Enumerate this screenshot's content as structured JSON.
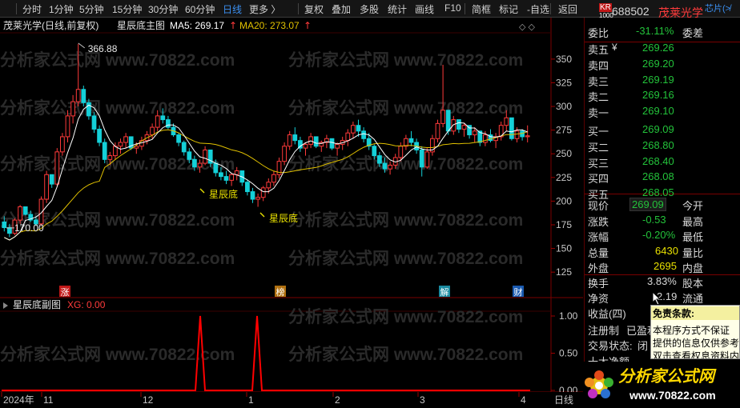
{
  "toolbar": {
    "items": [
      "分时",
      "1分钟",
      "5分钟",
      "15分钟",
      "30分钟",
      "60分钟",
      "日线",
      "更多 〉",
      "复权",
      "叠加",
      "多股",
      "统计",
      "画线",
      "F10",
      "简框",
      "标记",
      "-自选",
      "返回"
    ],
    "active": "日线"
  },
  "header": {
    "title": "茂莱光学(日线,前复权)",
    "indicator": "星辰底主图",
    "ma5_label": "MA5: 269.17",
    "ma20_label": "MA20: 273.07",
    "diamond_icons": "◇ ◇"
  },
  "sub_header": {
    "name": "星辰底副图",
    "xg_label": "XG: 0.00"
  },
  "chart_data": {
    "type": "candlestick",
    "y_ticks": [
      350.0,
      325.0,
      300.0,
      275.0,
      250.0,
      225.0,
      200.0,
      175.0,
      150.0,
      125.0
    ],
    "ylim": [
      115,
      382
    ],
    "high_label": "366.88",
    "low_label": "170.00",
    "x_labels": [
      "2024年",
      "11",
      "12",
      "1",
      "2",
      "3",
      "4"
    ],
    "x_axis_type": "日线",
    "sub_y_ticks": [
      "1.00",
      "0.50",
      "0.00"
    ],
    "annotations": [
      "星辰底",
      "星辰底"
    ],
    "event_markers": [
      "涨",
      "榜",
      "解",
      "财"
    ],
    "colors": {
      "up": "#ff3a3a",
      "down": "#14d0d8",
      "ma5": "#ffffff",
      "ma20": "#e0c000",
      "signal": "#ff0000"
    },
    "series": [
      {
        "name": "MA5"
      },
      {
        "name": "MA20"
      },
      {
        "name": "XG",
        "spikes_at": [
          "星辰底",
          "星辰底"
        ]
      }
    ],
    "candles": [
      [
        178,
        184,
        168,
        172
      ],
      [
        172,
        176,
        162,
        166
      ],
      [
        166,
        182,
        164,
        180
      ],
      [
        180,
        196,
        176,
        194
      ],
      [
        194,
        192,
        185,
        186
      ],
      [
        186,
        190,
        178,
        180
      ],
      [
        180,
        184,
        174,
        176
      ],
      [
        176,
        205,
        174,
        202
      ],
      [
        202,
        232,
        198,
        228
      ],
      [
        228,
        226,
        214,
        218
      ],
      [
        218,
        256,
        216,
        252
      ],
      [
        252,
        272,
        248,
        268
      ],
      [
        268,
        296,
        262,
        290
      ],
      [
        290,
        312,
        282,
        305
      ],
      [
        305,
        366,
        300,
        318
      ],
      [
        318,
        322,
        300,
        304
      ],
      [
        304,
        308,
        286,
        290
      ],
      [
        290,
        294,
        272,
        276
      ],
      [
        276,
        280,
        258,
        262
      ],
      [
        262,
        266,
        240,
        244
      ],
      [
        244,
        252,
        238,
        248
      ],
      [
        248,
        262,
        244,
        258
      ],
      [
        258,
        266,
        250,
        262
      ],
      [
        262,
        272,
        256,
        268
      ],
      [
        268,
        264,
        254,
        256
      ],
      [
        256,
        262,
        250,
        258
      ],
      [
        258,
        268,
        254,
        264
      ],
      [
        264,
        274,
        260,
        270
      ],
      [
        270,
        282,
        266,
        278
      ],
      [
        278,
        296,
        274,
        290
      ],
      [
        290,
        298,
        282,
        286
      ],
      [
        286,
        290,
        276,
        278
      ],
      [
        278,
        282,
        268,
        270
      ],
      [
        270,
        272,
        258,
        262
      ],
      [
        262,
        264,
        248,
        252
      ],
      [
        252,
        256,
        240,
        244
      ],
      [
        244,
        248,
        232,
        236
      ],
      [
        236,
        244,
        230,
        240
      ],
      [
        240,
        258,
        238,
        254
      ],
      [
        254,
        252,
        236,
        240
      ],
      [
        240,
        244,
        226,
        230
      ],
      [
        230,
        236,
        222,
        226
      ],
      [
        226,
        232,
        218,
        222
      ],
      [
        222,
        230,
        216,
        228
      ],
      [
        228,
        236,
        222,
        232
      ],
      [
        232,
        228,
        216,
        220
      ],
      [
        220,
        222,
        206,
        210
      ],
      [
        210,
        214,
        198,
        202
      ],
      [
        202,
        208,
        194,
        204
      ],
      [
        204,
        216,
        200,
        214
      ],
      [
        214,
        224,
        208,
        220
      ],
      [
        220,
        232,
        216,
        228
      ],
      [
        228,
        246,
        224,
        242
      ],
      [
        242,
        262,
        238,
        258
      ],
      [
        258,
        274,
        254,
        270
      ],
      [
        270,
        278,
        260,
        264
      ],
      [
        264,
        268,
        252,
        256
      ],
      [
        256,
        262,
        248,
        260
      ],
      [
        260,
        272,
        256,
        268
      ],
      [
        268,
        266,
        256,
        258
      ],
      [
        258,
        264,
        252,
        262
      ],
      [
        262,
        270,
        256,
        266
      ],
      [
        266,
        264,
        254,
        256
      ],
      [
        256,
        262,
        248,
        260
      ],
      [
        260,
        268,
        254,
        264
      ],
      [
        264,
        276,
        258,
        272
      ],
      [
        272,
        284,
        266,
        280
      ],
      [
        280,
        286,
        268,
        274
      ],
      [
        274,
        278,
        262,
        266
      ],
      [
        266,
        272,
        254,
        258
      ],
      [
        258,
        260,
        244,
        248
      ],
      [
        248,
        252,
        236,
        240
      ],
      [
        240,
        246,
        230,
        234
      ],
      [
        234,
        242,
        228,
        238
      ],
      [
        238,
        250,
        234,
        246
      ],
      [
        246,
        262,
        242,
        258
      ],
      [
        258,
        270,
        254,
        266
      ],
      [
        266,
        274,
        258,
        262
      ],
      [
        262,
        266,
        250,
        254
      ],
      [
        254,
        258,
        226,
        236
      ],
      [
        236,
        256,
        234,
        252
      ],
      [
        252,
        270,
        248,
        266
      ],
      [
        266,
        286,
        262,
        282
      ],
      [
        282,
        344,
        278,
        296
      ],
      [
        296,
        292,
        270,
        274
      ],
      [
        274,
        290,
        270,
        286
      ],
      [
        286,
        284,
        272,
        276
      ],
      [
        276,
        282,
        268,
        280
      ],
      [
        280,
        276,
        266,
        270
      ],
      [
        270,
        278,
        262,
        274
      ],
      [
        274,
        272,
        258,
        262
      ],
      [
        262,
        274,
        258,
        270
      ],
      [
        270,
        276,
        262,
        264
      ],
      [
        264,
        272,
        256,
        268
      ],
      [
        268,
        284,
        264,
        280
      ],
      [
        280,
        296,
        274,
        288
      ],
      [
        288,
        284,
        264,
        266
      ],
      [
        266,
        278,
        262,
        274
      ],
      [
        274,
        276,
        264,
        268
      ],
      [
        268,
        280,
        262,
        269
      ]
    ]
  },
  "right_panel": {
    "code_badge": "KR",
    "code_sub": "1000",
    "code": "688502",
    "name": "茂莱光学",
    "sector": "芯片(≯",
    "ratio_label": "委比",
    "ratio_value": "-31.11%",
    "ratio_diff_label": "委差",
    "asks": [
      {
        "label": "卖五",
        "price": "269.26"
      },
      {
        "label": "卖四",
        "price": "269.20"
      },
      {
        "label": "卖三",
        "price": "269.19"
      },
      {
        "label": "卖二",
        "price": "269.16"
      },
      {
        "label": "卖一",
        "price": "269.10"
      }
    ],
    "bids": [
      {
        "label": "买一",
        "price": "269.09"
      },
      {
        "label": "买二",
        "price": "268.80"
      },
      {
        "label": "买三",
        "price": "268.40"
      },
      {
        "label": "买四",
        "price": "268.08"
      },
      {
        "label": "买五",
        "price": "268.05"
      }
    ],
    "yen_icon": "¥",
    "stats": [
      {
        "l1": "现价",
        "v1": "269.09",
        "l2": "今开"
      },
      {
        "l1": "涨跌",
        "v1": "-0.53",
        "l2": "最高"
      },
      {
        "l1": "涨幅",
        "v1": "-0.20%",
        "l2": "最低"
      },
      {
        "l1": "总量",
        "v1": "6430",
        "l2": "量比"
      },
      {
        "l1": "外盘",
        "v1": "2695",
        "l2": "内盘"
      }
    ],
    "turnover_label": "换手",
    "turnover_value": "3.83%",
    "turnover_right": "股本",
    "net_asset_label": "净资",
    "net_asset_value": "2.19",
    "net_asset_right": "流通",
    "income_label": "收益(四)",
    "reg_label": "注册制",
    "reg_value": "已盈利",
    "trade_label": "交易状态:",
    "trade_value": "闭",
    "holder_label": "十大净额",
    "period_tab": "日线"
  },
  "tooltip": {
    "title": "免责条款:",
    "lines": [
      "本程序方式不保证",
      "提供的信息仅供参考",
      "双击查看权息资料内"
    ]
  },
  "watermark": "分析家公式网 www.70822.com",
  "logo": {
    "text": "分析家公式网",
    "url": "www.70822.com"
  }
}
